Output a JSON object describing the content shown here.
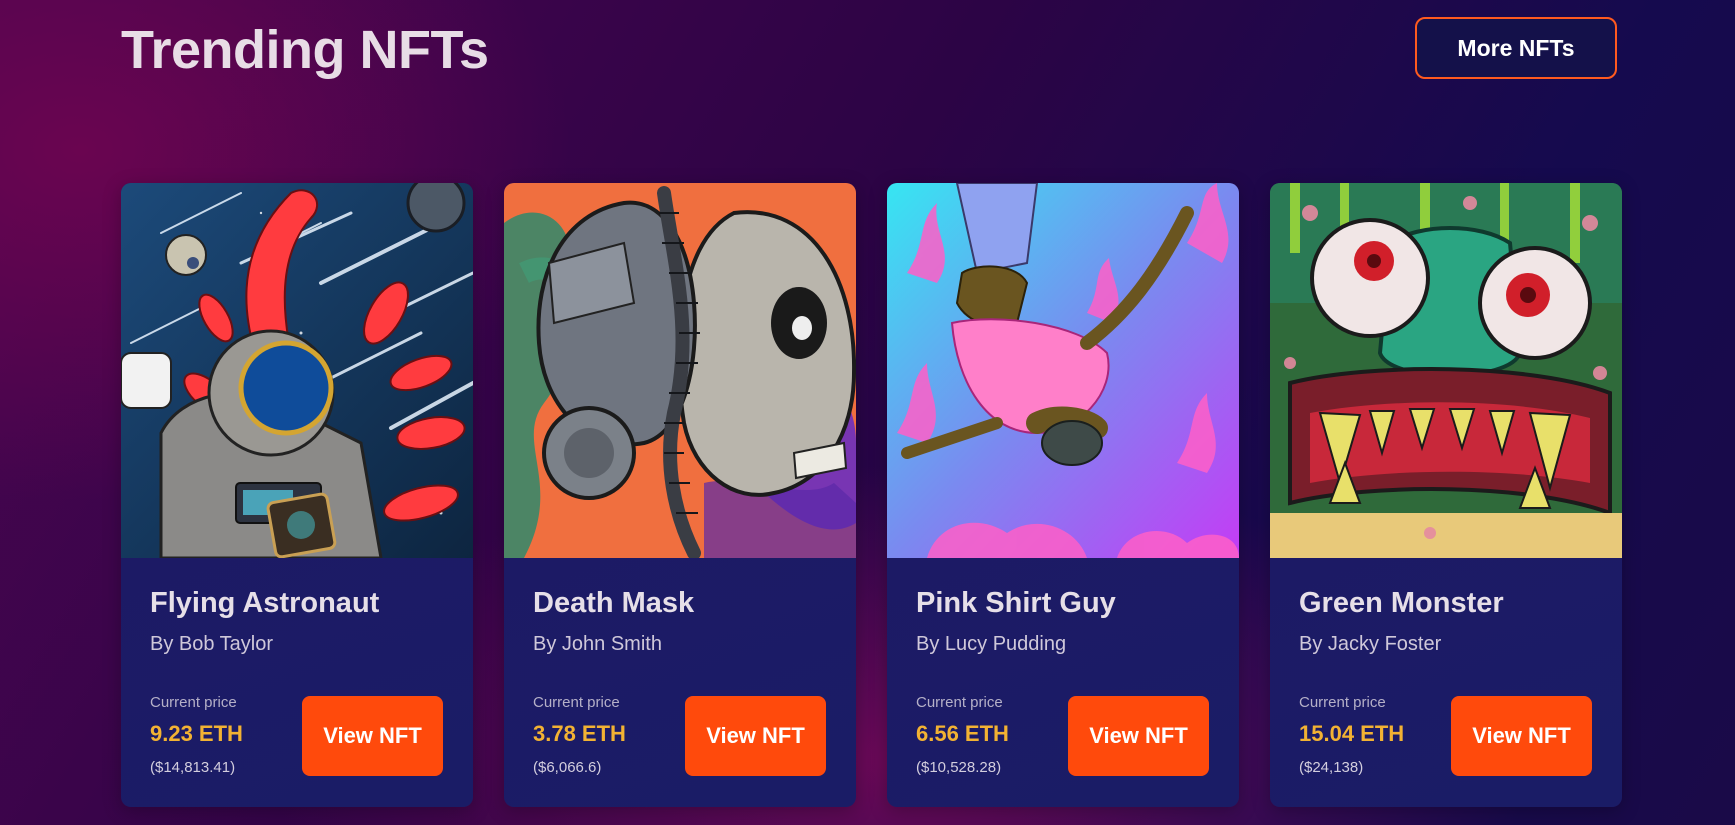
{
  "section": {
    "title": "Trending NFTs",
    "more_button_label": "More NFTs"
  },
  "cards": [
    {
      "name": "Flying Astronaut",
      "author": "By Bob Taylor",
      "price_label": "Current price",
      "price_eth": "9.23 ETH",
      "price_usd": "($14,813.41)",
      "button_label": "View NFT",
      "art": "astronaut-art"
    },
    {
      "name": "Death Mask",
      "author": "By John Smith",
      "price_label": "Current price",
      "price_eth": "3.78 ETH",
      "price_usd": "($6,066.6)",
      "button_label": "View NFT",
      "art": "skull-gasmask-art"
    },
    {
      "name": "Pink Shirt Guy",
      "author": "By Lucy Pudding",
      "price_label": "Current price",
      "price_eth": "6.56 ETH",
      "price_usd": "($10,528.28)",
      "button_label": "View NFT",
      "art": "falling-man-art"
    },
    {
      "name": "Green Monster",
      "author": "By Jacky Foster",
      "price_label": "Current price",
      "price_eth": "15.04 ETH",
      "price_usd": "($24,138)",
      "button_label": "View NFT",
      "art": "green-monster-art"
    }
  ],
  "colors": {
    "accent": "#ff4a0c",
    "price": "#f2b233",
    "card_bg": "#1d1a65",
    "button_border": "#ff5a1f"
  }
}
